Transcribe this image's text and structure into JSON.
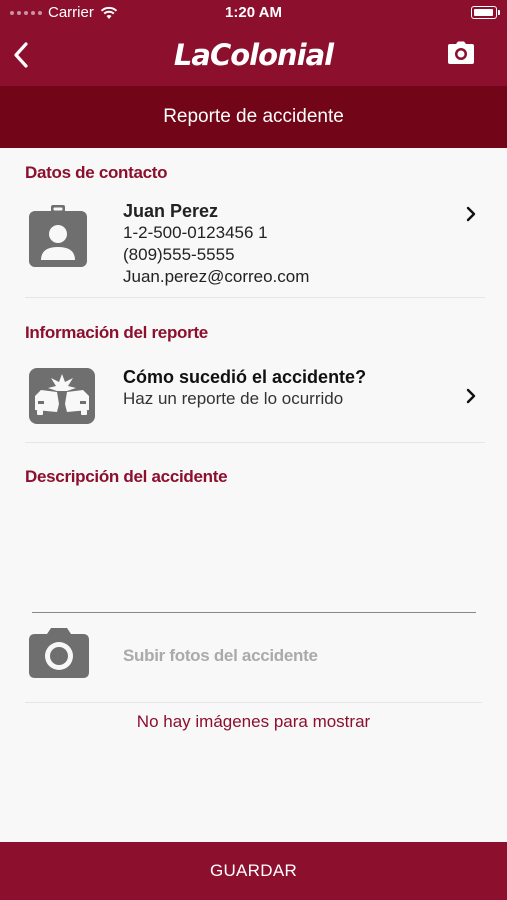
{
  "status_bar": {
    "carrier": "Carrier",
    "time": "1:20 AM",
    "battery_level": 1.0
  },
  "navbar": {
    "logo_text": "LaColonial",
    "back_icon": "chevron-left-icon",
    "camera_icon": "camera-icon"
  },
  "subheader": {
    "title": "Reporte de accidente"
  },
  "contact": {
    "section_title": "Datos de contacto",
    "name": "Juan Perez",
    "id": "1-2-500-0123456 1",
    "phone": "(809)555-5555",
    "email": "Juan.perez@correo.com",
    "icon": "contact-badge-icon"
  },
  "report": {
    "section_title": "Información del reporte",
    "title": "Cómo sucedió el accidente?",
    "subtitle": "Haz un reporte de lo ocurrido",
    "icon": "car-crash-icon"
  },
  "description": {
    "section_title": "Descripción del accidente"
  },
  "photos": {
    "upload_label": "Subir fotos del accidente",
    "empty_text": "No hay imágenes para mostrar",
    "icon": "camera-icon"
  },
  "footer": {
    "save_label": "GUARDAR"
  },
  "colors": {
    "brand": "#8c0f2e",
    "brand_dark": "#720618",
    "icon_gray": "#6f6f6f"
  }
}
